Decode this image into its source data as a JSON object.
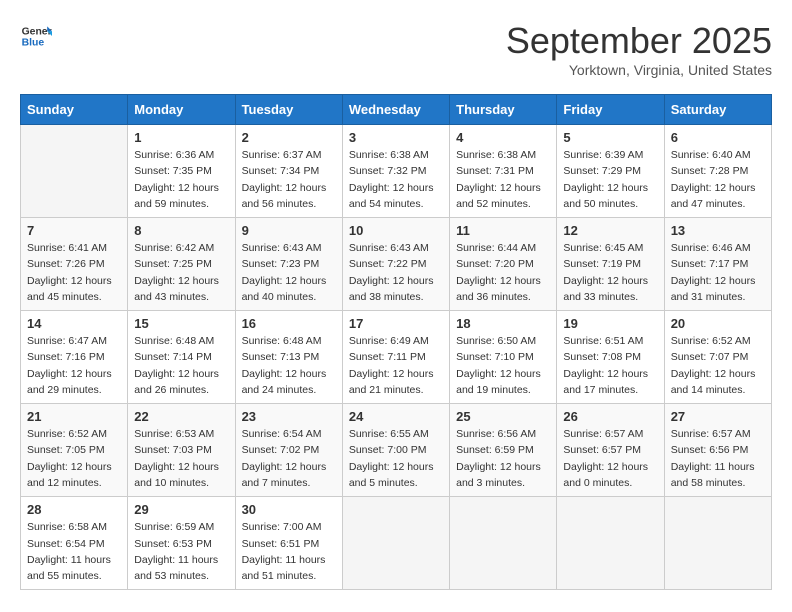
{
  "header": {
    "logo_line1": "General",
    "logo_line2": "Blue",
    "month": "September 2025",
    "location": "Yorktown, Virginia, United States"
  },
  "weekdays": [
    "Sunday",
    "Monday",
    "Tuesday",
    "Wednesday",
    "Thursday",
    "Friday",
    "Saturday"
  ],
  "weeks": [
    [
      {
        "day": "",
        "sunrise": "",
        "sunset": "",
        "daylight": "",
        "empty": true
      },
      {
        "day": "1",
        "sunrise": "Sunrise: 6:36 AM",
        "sunset": "Sunset: 7:35 PM",
        "daylight": "Daylight: 12 hours and 59 minutes."
      },
      {
        "day": "2",
        "sunrise": "Sunrise: 6:37 AM",
        "sunset": "Sunset: 7:34 PM",
        "daylight": "Daylight: 12 hours and 56 minutes."
      },
      {
        "day": "3",
        "sunrise": "Sunrise: 6:38 AM",
        "sunset": "Sunset: 7:32 PM",
        "daylight": "Daylight: 12 hours and 54 minutes."
      },
      {
        "day": "4",
        "sunrise": "Sunrise: 6:38 AM",
        "sunset": "Sunset: 7:31 PM",
        "daylight": "Daylight: 12 hours and 52 minutes."
      },
      {
        "day": "5",
        "sunrise": "Sunrise: 6:39 AM",
        "sunset": "Sunset: 7:29 PM",
        "daylight": "Daylight: 12 hours and 50 minutes."
      },
      {
        "day": "6",
        "sunrise": "Sunrise: 6:40 AM",
        "sunset": "Sunset: 7:28 PM",
        "daylight": "Daylight: 12 hours and 47 minutes."
      }
    ],
    [
      {
        "day": "7",
        "sunrise": "Sunrise: 6:41 AM",
        "sunset": "Sunset: 7:26 PM",
        "daylight": "Daylight: 12 hours and 45 minutes."
      },
      {
        "day": "8",
        "sunrise": "Sunrise: 6:42 AM",
        "sunset": "Sunset: 7:25 PM",
        "daylight": "Daylight: 12 hours and 43 minutes."
      },
      {
        "day": "9",
        "sunrise": "Sunrise: 6:43 AM",
        "sunset": "Sunset: 7:23 PM",
        "daylight": "Daylight: 12 hours and 40 minutes."
      },
      {
        "day": "10",
        "sunrise": "Sunrise: 6:43 AM",
        "sunset": "Sunset: 7:22 PM",
        "daylight": "Daylight: 12 hours and 38 minutes."
      },
      {
        "day": "11",
        "sunrise": "Sunrise: 6:44 AM",
        "sunset": "Sunset: 7:20 PM",
        "daylight": "Daylight: 12 hours and 36 minutes."
      },
      {
        "day": "12",
        "sunrise": "Sunrise: 6:45 AM",
        "sunset": "Sunset: 7:19 PM",
        "daylight": "Daylight: 12 hours and 33 minutes."
      },
      {
        "day": "13",
        "sunrise": "Sunrise: 6:46 AM",
        "sunset": "Sunset: 7:17 PM",
        "daylight": "Daylight: 12 hours and 31 minutes."
      }
    ],
    [
      {
        "day": "14",
        "sunrise": "Sunrise: 6:47 AM",
        "sunset": "Sunset: 7:16 PM",
        "daylight": "Daylight: 12 hours and 29 minutes."
      },
      {
        "day": "15",
        "sunrise": "Sunrise: 6:48 AM",
        "sunset": "Sunset: 7:14 PM",
        "daylight": "Daylight: 12 hours and 26 minutes."
      },
      {
        "day": "16",
        "sunrise": "Sunrise: 6:48 AM",
        "sunset": "Sunset: 7:13 PM",
        "daylight": "Daylight: 12 hours and 24 minutes."
      },
      {
        "day": "17",
        "sunrise": "Sunrise: 6:49 AM",
        "sunset": "Sunset: 7:11 PM",
        "daylight": "Daylight: 12 hours and 21 minutes."
      },
      {
        "day": "18",
        "sunrise": "Sunrise: 6:50 AM",
        "sunset": "Sunset: 7:10 PM",
        "daylight": "Daylight: 12 hours and 19 minutes."
      },
      {
        "day": "19",
        "sunrise": "Sunrise: 6:51 AM",
        "sunset": "Sunset: 7:08 PM",
        "daylight": "Daylight: 12 hours and 17 minutes."
      },
      {
        "day": "20",
        "sunrise": "Sunrise: 6:52 AM",
        "sunset": "Sunset: 7:07 PM",
        "daylight": "Daylight: 12 hours and 14 minutes."
      }
    ],
    [
      {
        "day": "21",
        "sunrise": "Sunrise: 6:52 AM",
        "sunset": "Sunset: 7:05 PM",
        "daylight": "Daylight: 12 hours and 12 minutes."
      },
      {
        "day": "22",
        "sunrise": "Sunrise: 6:53 AM",
        "sunset": "Sunset: 7:03 PM",
        "daylight": "Daylight: 12 hours and 10 minutes."
      },
      {
        "day": "23",
        "sunrise": "Sunrise: 6:54 AM",
        "sunset": "Sunset: 7:02 PM",
        "daylight": "Daylight: 12 hours and 7 minutes."
      },
      {
        "day": "24",
        "sunrise": "Sunrise: 6:55 AM",
        "sunset": "Sunset: 7:00 PM",
        "daylight": "Daylight: 12 hours and 5 minutes."
      },
      {
        "day": "25",
        "sunrise": "Sunrise: 6:56 AM",
        "sunset": "Sunset: 6:59 PM",
        "daylight": "Daylight: 12 hours and 3 minutes."
      },
      {
        "day": "26",
        "sunrise": "Sunrise: 6:57 AM",
        "sunset": "Sunset: 6:57 PM",
        "daylight": "Daylight: 12 hours and 0 minutes."
      },
      {
        "day": "27",
        "sunrise": "Sunrise: 6:57 AM",
        "sunset": "Sunset: 6:56 PM",
        "daylight": "Daylight: 11 hours and 58 minutes."
      }
    ],
    [
      {
        "day": "28",
        "sunrise": "Sunrise: 6:58 AM",
        "sunset": "Sunset: 6:54 PM",
        "daylight": "Daylight: 11 hours and 55 minutes."
      },
      {
        "day": "29",
        "sunrise": "Sunrise: 6:59 AM",
        "sunset": "Sunset: 6:53 PM",
        "daylight": "Daylight: 11 hours and 53 minutes."
      },
      {
        "day": "30",
        "sunrise": "Sunrise: 7:00 AM",
        "sunset": "Sunset: 6:51 PM",
        "daylight": "Daylight: 11 hours and 51 minutes."
      },
      {
        "day": "",
        "sunrise": "",
        "sunset": "",
        "daylight": "",
        "empty": true
      },
      {
        "day": "",
        "sunrise": "",
        "sunset": "",
        "daylight": "",
        "empty": true
      },
      {
        "day": "",
        "sunrise": "",
        "sunset": "",
        "daylight": "",
        "empty": true
      },
      {
        "day": "",
        "sunrise": "",
        "sunset": "",
        "daylight": "",
        "empty": true
      }
    ]
  ]
}
